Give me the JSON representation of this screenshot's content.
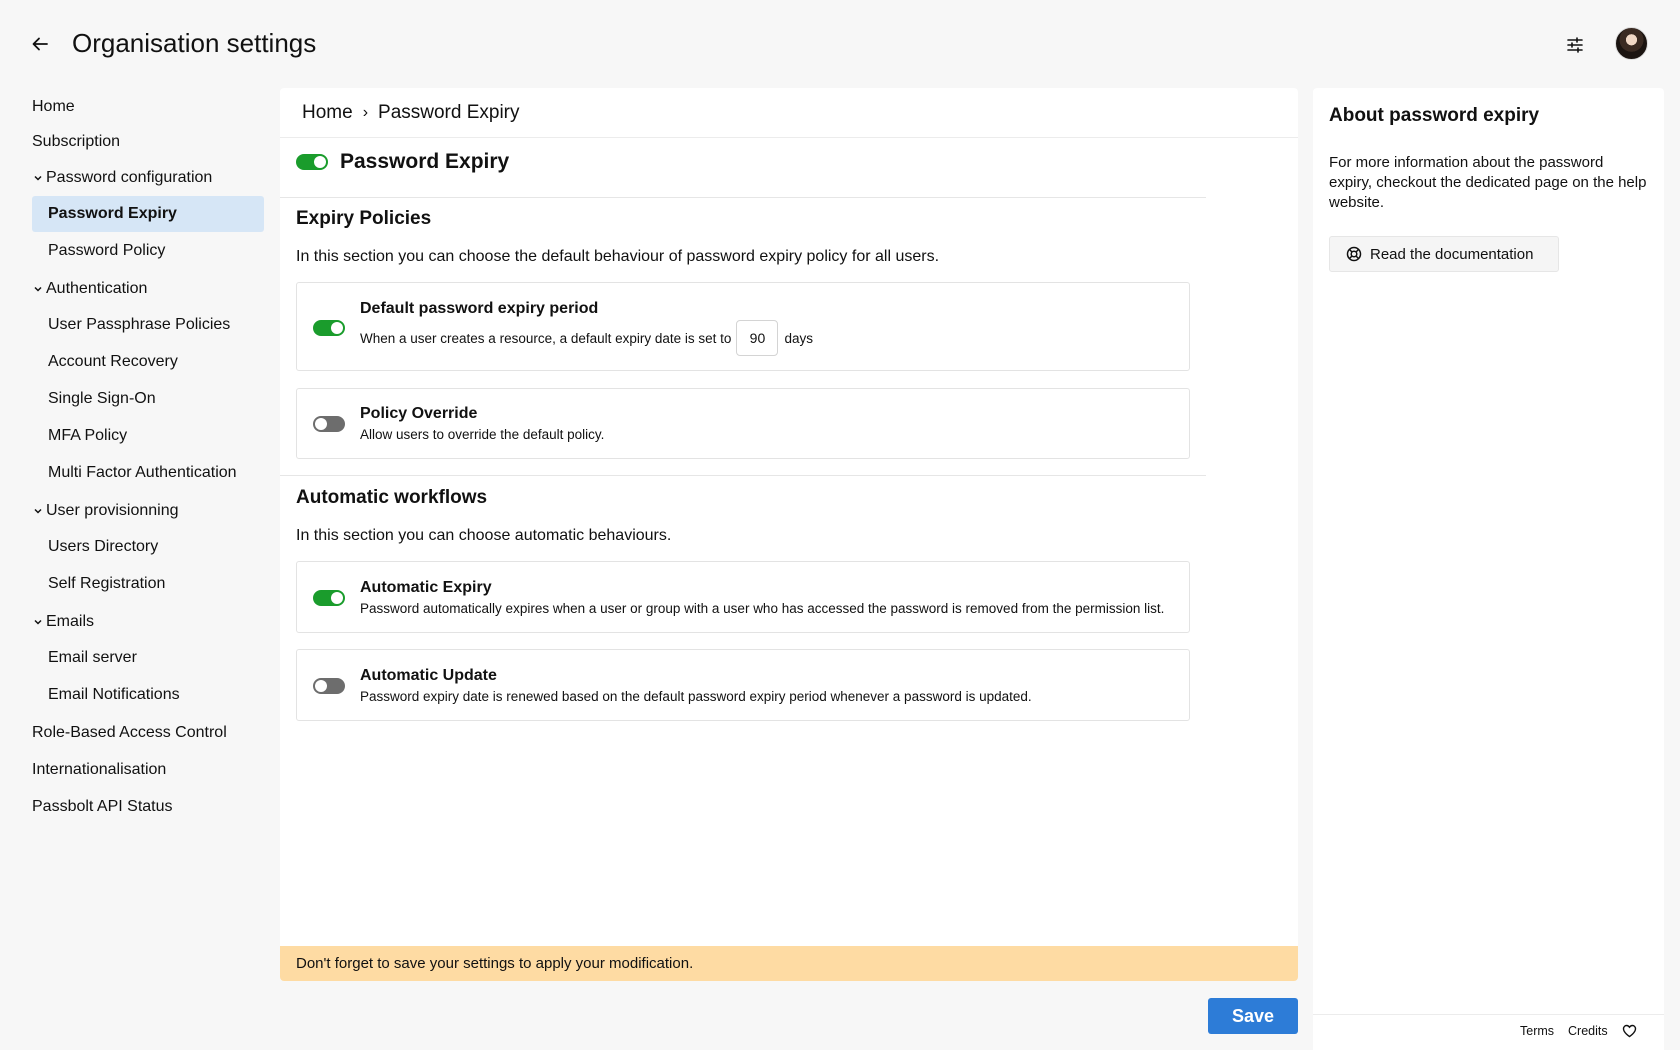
{
  "header": {
    "title": "Organisation settings",
    "back_icon": "arrow-left-icon",
    "filter_icon": "sliders-icon"
  },
  "sidebar": {
    "items": [
      {
        "label": "Home"
      },
      {
        "label": "Subscription"
      },
      {
        "label": "Password configuration"
      },
      {
        "label": "Password Expiry"
      },
      {
        "label": "Password Policy"
      },
      {
        "label": "Authentication"
      },
      {
        "label": "User Passphrase Policies"
      },
      {
        "label": "Account Recovery"
      },
      {
        "label": "Single Sign-On"
      },
      {
        "label": "MFA Policy"
      },
      {
        "label": "Multi Factor Authentication"
      },
      {
        "label": "User provisionning"
      },
      {
        "label": "Users Directory"
      },
      {
        "label": "Self Registration"
      },
      {
        "label": "Emails"
      },
      {
        "label": "Email server"
      },
      {
        "label": "Email Notifications"
      },
      {
        "label": "Role-Based Access Control"
      },
      {
        "label": "Internationalisation"
      },
      {
        "label": "Passbolt API Status"
      }
    ],
    "active": "Password Expiry"
  },
  "breadcrumb": {
    "home": "Home",
    "separator": "›",
    "current": "Password Expiry"
  },
  "feature": {
    "title": "Password Expiry",
    "enabled": true
  },
  "expiry_policies": {
    "title": "Expiry Policies",
    "description": "In this section you can choose the default behaviour of password expiry policy for all users.",
    "default_period": {
      "title": "Default password expiry period",
      "desc_before": "When a user creates a resource, a default expiry date is set to",
      "days_value": "90",
      "desc_after": "days",
      "enabled": true
    },
    "policy_override": {
      "title": "Policy Override",
      "desc": "Allow users to override the default policy.",
      "enabled": false
    }
  },
  "workflows": {
    "title": "Automatic workflows",
    "description": "In this section you can choose automatic behaviours.",
    "automatic_expiry": {
      "title": "Automatic Expiry",
      "desc": "Password automatically expires when a user or group with a user who has accessed the password is removed from the permission list.",
      "enabled": true
    },
    "automatic_update": {
      "title": "Automatic Update",
      "desc": "Password expiry date is renewed based on the default password expiry period whenever a password is updated.",
      "enabled": false
    }
  },
  "warning": "Don't forget to save your settings to apply your modification.",
  "save_label": "Save",
  "aside": {
    "title": "About password expiry",
    "text": "For more information about the password expiry, checkout the dedicated page on the help website.",
    "doc_button": "Read the documentation",
    "doc_icon": "life-ring-icon"
  },
  "footer": {
    "terms": "Terms",
    "credits": "Credits",
    "heart_icon": "heart-icon"
  },
  "colors": {
    "toggle_on": "#1a9c2c",
    "toggle_off": "#6d6d6d",
    "active_nav": "#d6e6f6",
    "warning_bg": "#fedba3",
    "save_bg": "#2d7cd7"
  }
}
